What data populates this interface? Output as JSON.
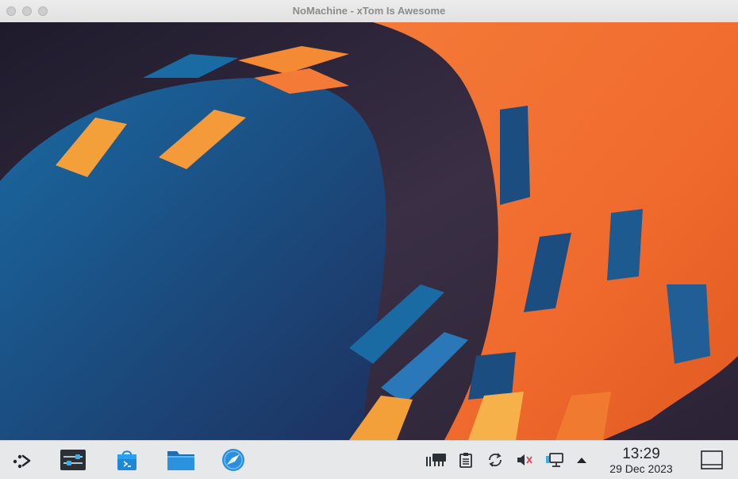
{
  "window": {
    "title": "NoMachine - xTom Is Awesome",
    "controls": [
      "close",
      "minimize",
      "zoom"
    ]
  },
  "desktop": {
    "wallpaper": "kde-plasma-abstract-orange-blue"
  },
  "taskbar": {
    "launchers": [
      {
        "name": "application-launcher",
        "icon": "kde-launcher-icon"
      },
      {
        "name": "system-settings",
        "icon": "settings-sliders-icon"
      },
      {
        "name": "discover",
        "icon": "software-store-icon"
      },
      {
        "name": "dolphin",
        "icon": "folder-icon"
      },
      {
        "name": "web-browser",
        "icon": "compass-icon"
      }
    ],
    "tray": [
      {
        "name": "nomachine-tray",
        "icon": "nomachine-icon"
      },
      {
        "name": "clipboard",
        "icon": "clipboard-icon"
      },
      {
        "name": "updates",
        "icon": "sync-icon"
      },
      {
        "name": "volume",
        "icon": "volume-muted-icon"
      },
      {
        "name": "network",
        "icon": "network-wired-icon"
      },
      {
        "name": "show-hidden",
        "icon": "arrow-up-icon"
      }
    ],
    "clock": {
      "time": "13:29",
      "date": "29 Dec 2023"
    },
    "peek": {
      "name": "show-desktop",
      "icon": "show-desktop-icon"
    }
  },
  "colors": {
    "accent_orange": "#f26b30",
    "accent_blue": "#1d6ea8",
    "folder_blue": "#1e88d8",
    "taskbar_bg": "#e7e8ea"
  }
}
